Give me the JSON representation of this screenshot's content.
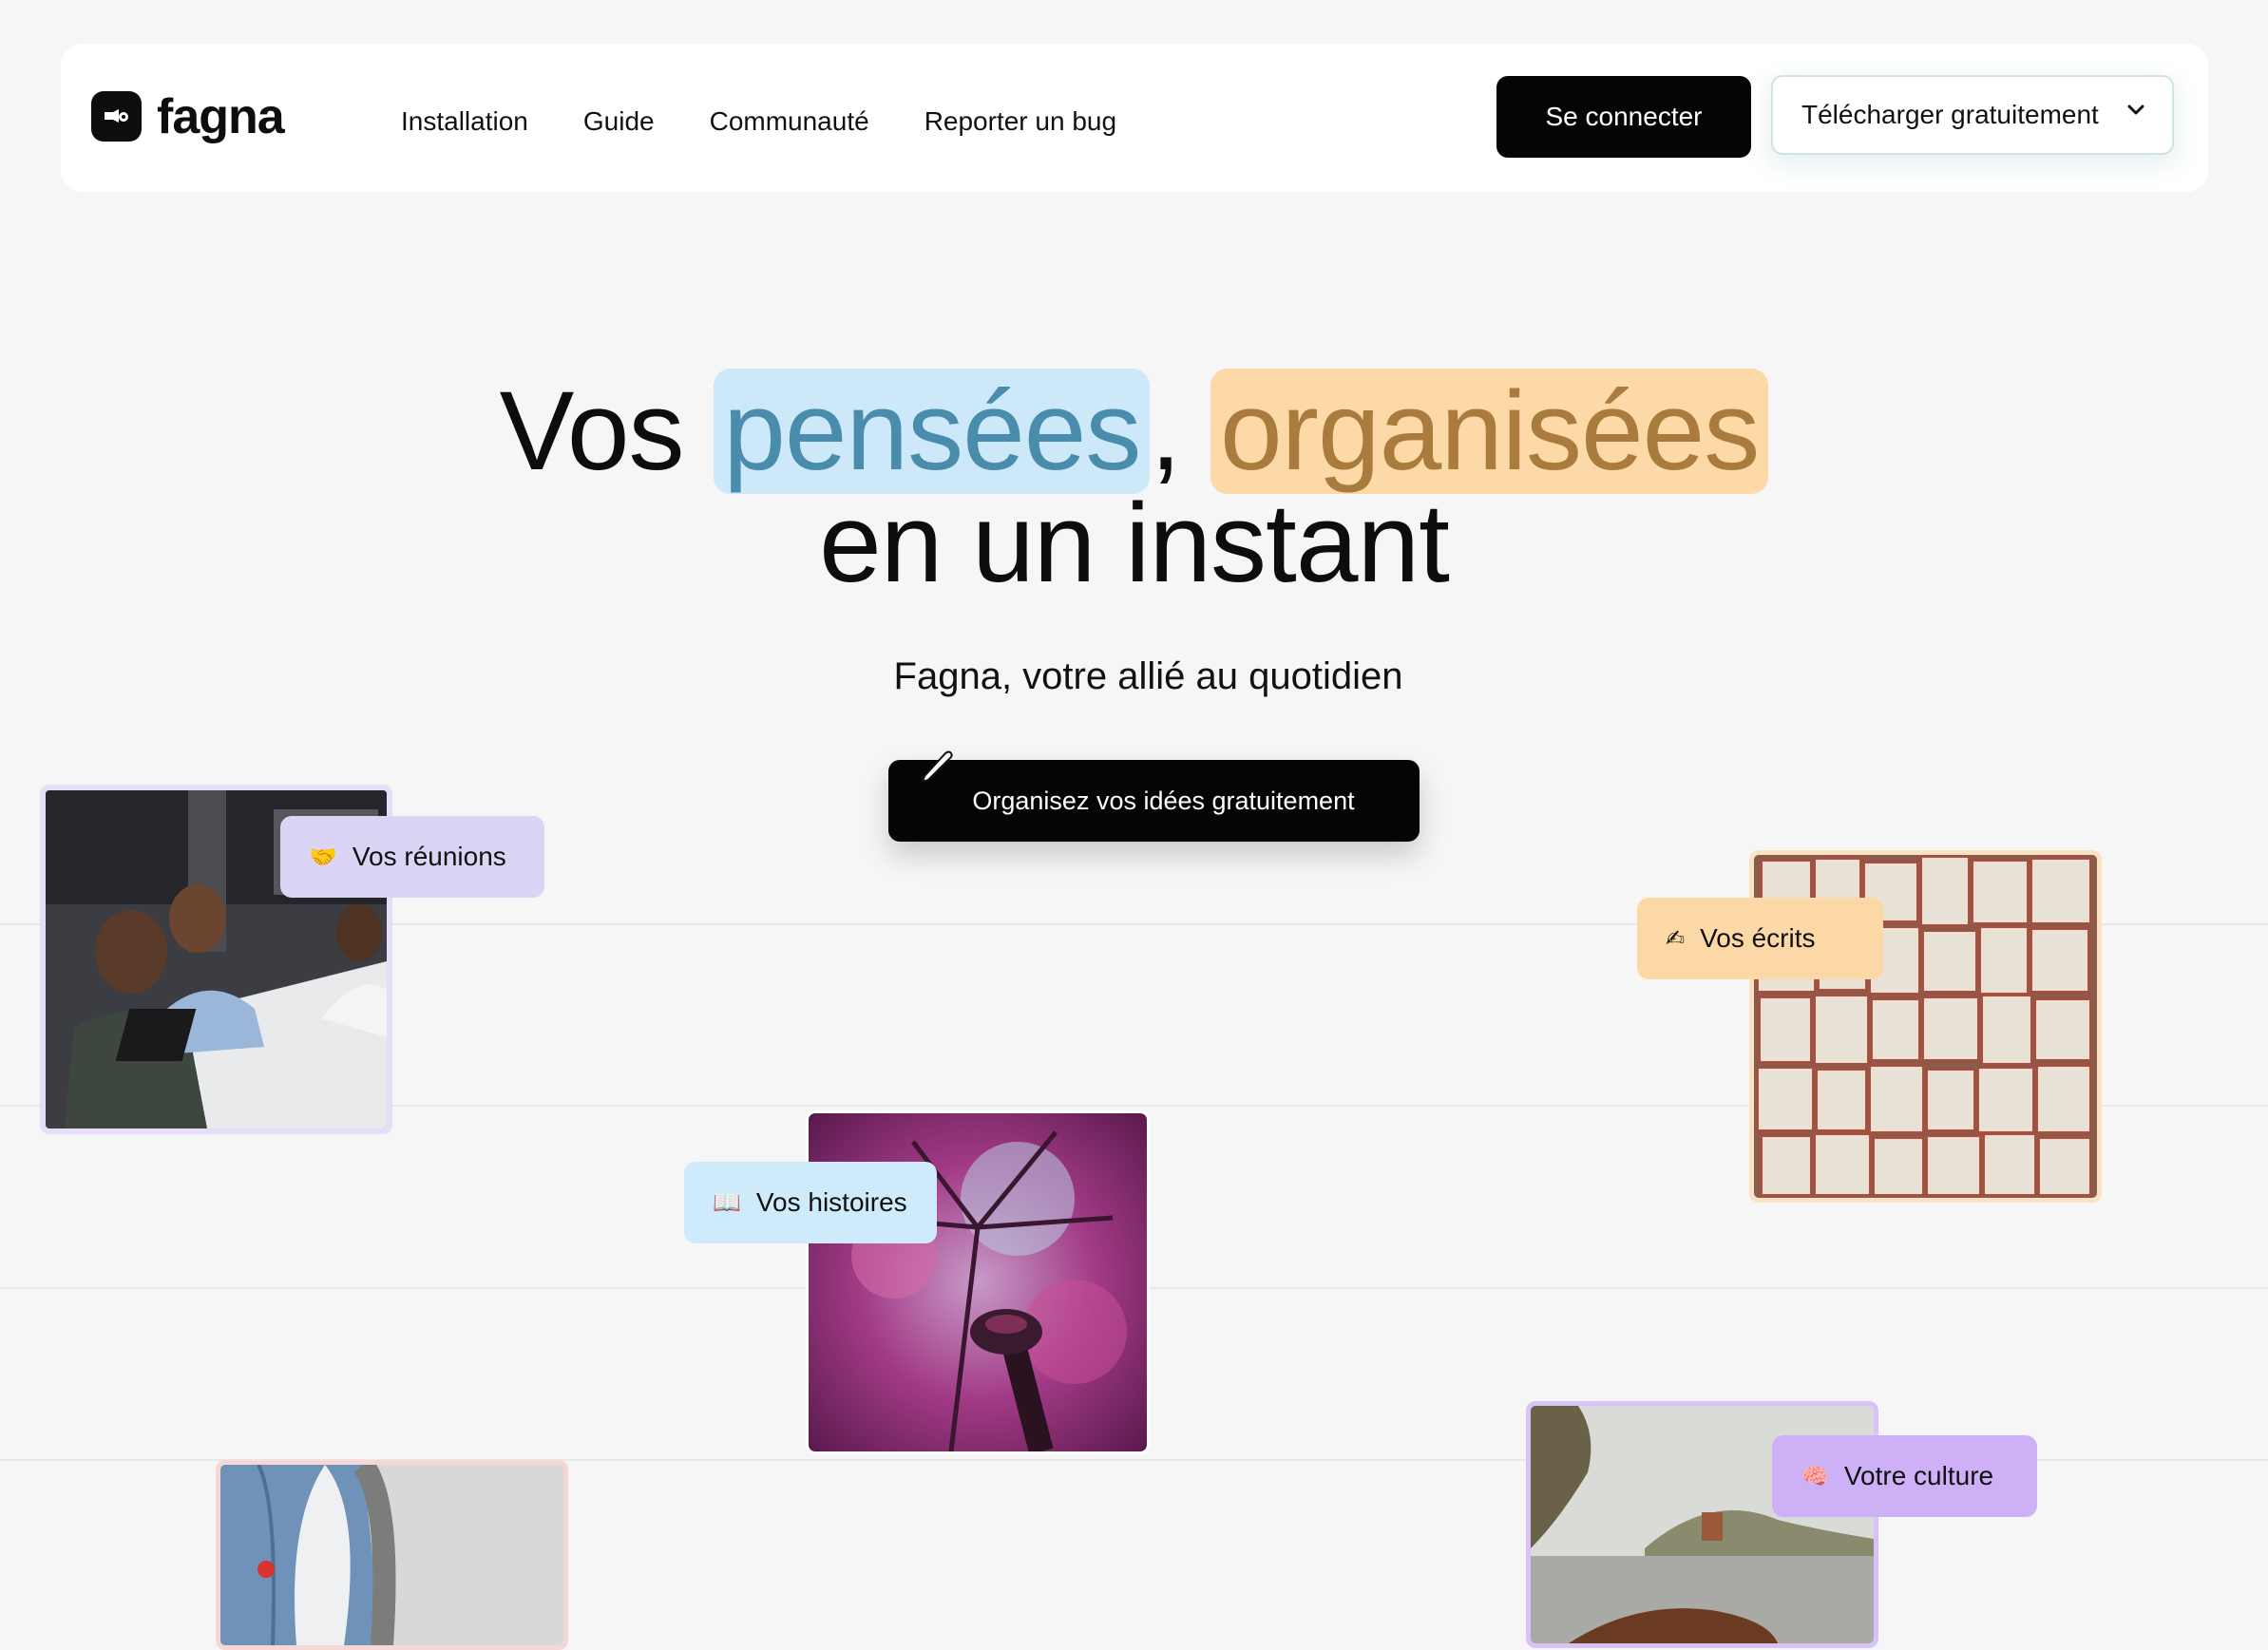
{
  "brand": {
    "name": "fagna"
  },
  "nav": {
    "links": [
      "Installation",
      "Guide",
      "Communauté",
      "Reporter un bug"
    ],
    "login_label": "Se connecter",
    "download_label": "Télécharger gratuitement"
  },
  "hero": {
    "title_word1": "Vos",
    "title_highlight1": "pensées",
    "title_comma": ",",
    "title_highlight2": "organisées",
    "title_line2": "en un instant",
    "subtitle": "Fagna, votre allié au quotidien",
    "cta_label": "Organisez vos idées gratuitement"
  },
  "cards": [
    {
      "label": "Vos réunions",
      "emoji": "🤝",
      "tag_color": "#dcd4f5",
      "border_color": "#e6ddf8"
    },
    {
      "label": "Vos histoires",
      "emoji": "📖",
      "tag_color": "#cfeafa",
      "border_color": "#ffffff"
    },
    {
      "label": "Vos écrits",
      "emoji": "✍",
      "tag_color": "#fcd8a6",
      "border_color": "#fbe2c3"
    },
    {
      "label": "Votre culture",
      "emoji": "🧠",
      "tag_color": "#cdb0f6",
      "border_color": "#d8c2f7"
    },
    {
      "label": "",
      "emoji": "",
      "tag_color": "",
      "border_color": "#f7d6d6"
    }
  ],
  "colors": {
    "background": "#f6f6f6",
    "primary": "#050505",
    "highlight_blue": "#cde9f9",
    "highlight_orange": "#fcd9a7"
  },
  "icons": [
    "logo-icon",
    "chevron-down-icon",
    "pen-icon",
    "handshake-icon",
    "book-icon",
    "writing-hand-icon",
    "brain-icon"
  ]
}
